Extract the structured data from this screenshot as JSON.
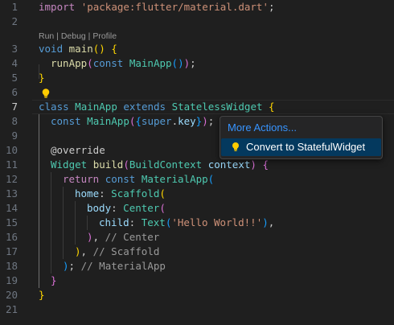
{
  "editor": {
    "line_numbers": [
      "1",
      "2",
      "3",
      "4",
      "5",
      "6",
      "7",
      "8",
      "9",
      "10",
      "11",
      "12",
      "13",
      "14",
      "15",
      "16",
      "17",
      "18",
      "19",
      "20",
      "21"
    ],
    "active_line": "7",
    "codelens": "Run | Debug | Profile",
    "lightbulb_icon": "lightbulb-icon",
    "lines": {
      "l1": [
        "import",
        " ",
        "'package:flutter/material.dart'",
        ";"
      ],
      "l3": [
        "void",
        " ",
        "main",
        "()",
        " ",
        "{"
      ],
      "l4": [
        "runApp",
        "(",
        "const",
        " ",
        "MainApp",
        "()",
        ")",
        ";"
      ],
      "l5": [
        "}"
      ],
      "l7": [
        "class",
        " ",
        "MainApp",
        " ",
        "extends",
        " ",
        "StatelessWidget",
        " ",
        "{"
      ],
      "l8": [
        "const",
        " ",
        "MainApp",
        "(",
        "{",
        "super",
        ".",
        "key",
        "}",
        ")",
        ";"
      ],
      "l10": [
        "@override"
      ],
      "l11": [
        "Widget",
        " ",
        "build",
        "(",
        "BuildContext",
        " ",
        "context",
        ")",
        " ",
        "{"
      ],
      "l12": [
        "return",
        " ",
        "const",
        " ",
        "MaterialApp",
        "("
      ],
      "l13": [
        "home",
        ": ",
        "Scaffold",
        "("
      ],
      "l14": [
        "body",
        ": ",
        "Center",
        "("
      ],
      "l15": [
        "child",
        ": ",
        "Text",
        "(",
        "'Hello World!!'",
        ")",
        ","
      ],
      "l16": [
        ")",
        ", ",
        "// Center"
      ],
      "l17": [
        ")",
        ", ",
        "// Scaffold"
      ],
      "l18": [
        ")",
        "; ",
        "// MaterialApp"
      ],
      "l19": [
        "}"
      ],
      "l20": [
        "}"
      ]
    }
  },
  "menu": {
    "title": "More Actions...",
    "item_label": "Convert to StatefulWidget",
    "item_icon": "lightbulb-icon"
  },
  "colors": {
    "background": "#1f1f1f",
    "menu_title": "#3794ff",
    "menu_selection": "#04395e",
    "lightbulb": "#ffcc00"
  }
}
